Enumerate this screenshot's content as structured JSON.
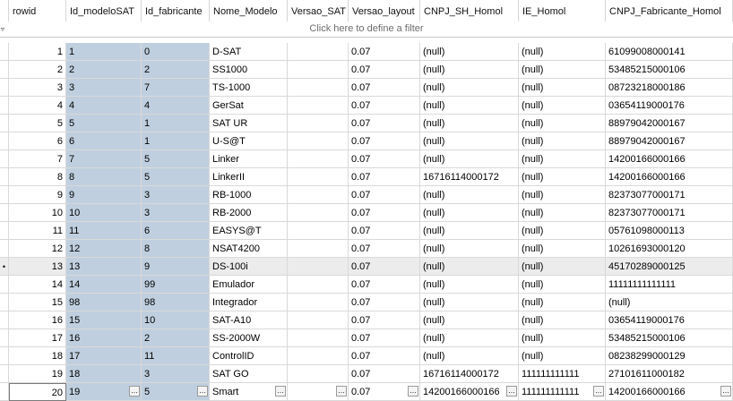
{
  "filter_hint": "Click here to define a filter",
  "columns": [
    "rowid",
    "Id_modeloSAT",
    "Id_fabricante",
    "Nome_Modelo",
    "Versao_SAT",
    "Versao_layout",
    "CNPJ_SH_Homol",
    "IE_Homol",
    "CNPJ_Fabricante_Homol"
  ],
  "current_row_marker": "•",
  "ellipsis_label": "...",
  "rows": [
    [
      "1",
      "1",
      "0",
      "D-SAT",
      "",
      "0.07",
      "(null)",
      "(null)",
      "61099008000141"
    ],
    [
      "2",
      "2",
      "2",
      "SS1000",
      "",
      "0.07",
      "(null)",
      "(null)",
      "53485215000106"
    ],
    [
      "3",
      "3",
      "7",
      "TS-1000",
      "",
      "0.07",
      "(null)",
      "(null)",
      "08723218000186"
    ],
    [
      "4",
      "4",
      "4",
      "GerSat",
      "",
      "0.07",
      "(null)",
      "(null)",
      "03654119000176"
    ],
    [
      "5",
      "5",
      "1",
      "SAT UR",
      "",
      "0.07",
      "(null)",
      "(null)",
      "88979042000167"
    ],
    [
      "6",
      "6",
      "1",
      "U-S@T",
      "",
      "0.07",
      "(null)",
      "(null)",
      "88979042000167"
    ],
    [
      "7",
      "7",
      "5",
      "Linker",
      "",
      "0.07",
      "(null)",
      "(null)",
      "14200166000166"
    ],
    [
      "8",
      "8",
      "5",
      "LinkerII",
      "",
      "0.07",
      "16716114000172",
      "(null)",
      "14200166000166"
    ],
    [
      "9",
      "9",
      "3",
      "RB-1000",
      "",
      "0.07",
      "(null)",
      "(null)",
      "82373077000171"
    ],
    [
      "10",
      "10",
      "3",
      "RB-2000",
      "",
      "0.07",
      "(null)",
      "(null)",
      "82373077000171"
    ],
    [
      "11",
      "11",
      "6",
      "EASYS@T",
      "",
      "0.07",
      "(null)",
      "(null)",
      "05761098000113"
    ],
    [
      "12",
      "12",
      "8",
      "NSAT4200",
      "",
      "0.07",
      "(null)",
      "(null)",
      "10261693000120"
    ],
    [
      "13",
      "13",
      "9",
      "DS-100i",
      "",
      "0.07",
      "(null)",
      "(null)",
      "45170289000125"
    ],
    [
      "14",
      "14",
      "99",
      "Emulador",
      "",
      "0.07",
      "(null)",
      "(null)",
      "11111111111111"
    ],
    [
      "15",
      "98",
      "98",
      "Integrador",
      "",
      "0.07",
      "(null)",
      "(null)",
      "(null)"
    ],
    [
      "16",
      "15",
      "10",
      "SAT-A10",
      "",
      "0.07",
      "(null)",
      "(null)",
      "03654119000176"
    ],
    [
      "17",
      "16",
      "2",
      "SS-2000W",
      "",
      "0.07",
      "(null)",
      "(null)",
      "53485215000106"
    ],
    [
      "18",
      "17",
      "11",
      "ControlID",
      "",
      "0.07",
      "(null)",
      "(null)",
      "08238299000129"
    ],
    [
      "19",
      "18",
      "3",
      "SAT GO",
      "",
      "0.07",
      "16716114000172",
      "111111111111",
      "27101611000182"
    ],
    [
      "20",
      "19",
      "5",
      "Smart",
      "",
      "0.07",
      "14200166000166",
      "111111111111",
      "14200166000166"
    ]
  ]
}
